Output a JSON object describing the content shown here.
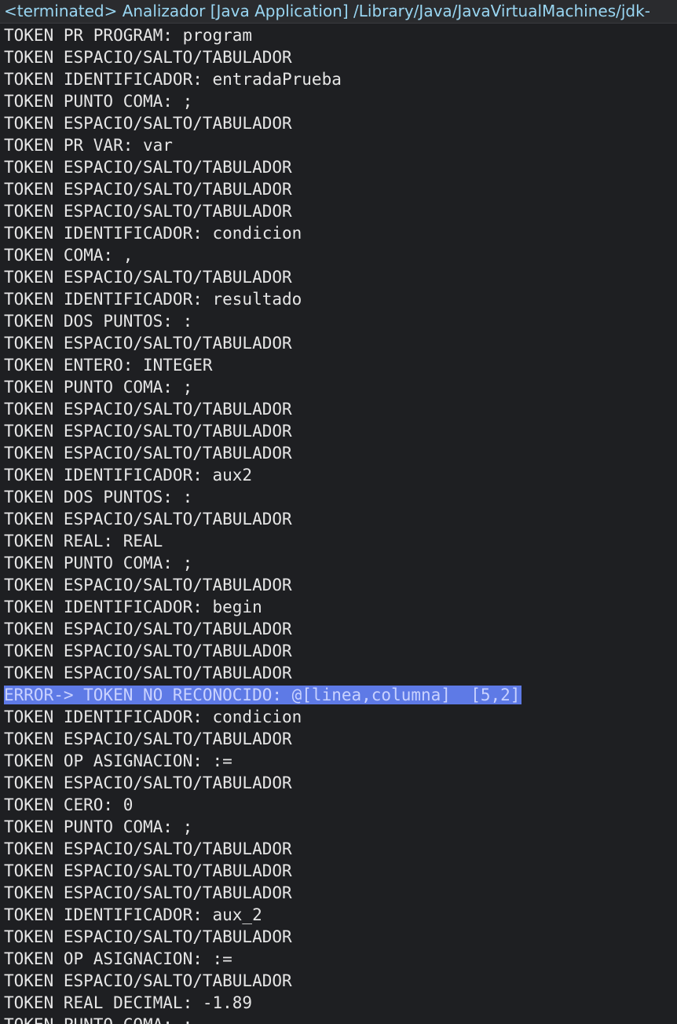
{
  "header": {
    "title": "<terminated> Analizador [Java Application] /Library/Java/JavaVirtualMachines/jdk-"
  },
  "colors": {
    "background": "#1e1f22",
    "header_text": "#99d6f2",
    "output_text": "#e6e6e6",
    "selection_background": "#5e7ae6",
    "selection_text": "#c9d2ff"
  },
  "console": {
    "lines": [
      "TOKEN PR PROGRAM: program",
      "TOKEN ESPACIO/SALTO/TABULADOR",
      "TOKEN IDENTIFICADOR: entradaPrueba",
      "TOKEN PUNTO COMA: ;",
      "TOKEN ESPACIO/SALTO/TABULADOR",
      "TOKEN PR VAR: var",
      "TOKEN ESPACIO/SALTO/TABULADOR",
      "TOKEN ESPACIO/SALTO/TABULADOR",
      "TOKEN ESPACIO/SALTO/TABULADOR",
      "TOKEN IDENTIFICADOR: condicion",
      "TOKEN COMA: ,",
      "TOKEN ESPACIO/SALTO/TABULADOR",
      "TOKEN IDENTIFICADOR: resultado",
      "TOKEN DOS PUNTOS: :",
      "TOKEN ESPACIO/SALTO/TABULADOR",
      "TOKEN ENTERO: INTEGER",
      "TOKEN PUNTO COMA: ;",
      "TOKEN ESPACIO/SALTO/TABULADOR",
      "TOKEN ESPACIO/SALTO/TABULADOR",
      "TOKEN ESPACIO/SALTO/TABULADOR",
      "TOKEN IDENTIFICADOR: aux2",
      "TOKEN DOS PUNTOS: :",
      "TOKEN ESPACIO/SALTO/TABULADOR",
      "TOKEN REAL: REAL",
      "TOKEN PUNTO COMA: ;",
      "TOKEN ESPACIO/SALTO/TABULADOR",
      "TOKEN IDENTIFICADOR: begin",
      "TOKEN ESPACIO/SALTO/TABULADOR",
      "TOKEN ESPACIO/SALTO/TABULADOR",
      "TOKEN ESPACIO/SALTO/TABULADOR",
      "ERROR-> TOKEN NO RECONOCIDO: @[linea,columna]  [5,2]",
      "TOKEN IDENTIFICADOR: condicion",
      "TOKEN ESPACIO/SALTO/TABULADOR",
      "TOKEN OP ASIGNACION: :=",
      "TOKEN ESPACIO/SALTO/TABULADOR",
      "TOKEN CERO: 0",
      "TOKEN PUNTO COMA: ;",
      "TOKEN ESPACIO/SALTO/TABULADOR",
      "TOKEN ESPACIO/SALTO/TABULADOR",
      "TOKEN ESPACIO/SALTO/TABULADOR",
      "TOKEN IDENTIFICADOR: aux_2",
      "TOKEN ESPACIO/SALTO/TABULADOR",
      "TOKEN OP ASIGNACION: :=",
      "TOKEN ESPACIO/SALTO/TABULADOR",
      "TOKEN REAL DECIMAL: -1.89",
      "TOKEN PUNTO COMA: ;"
    ],
    "highlighted_line": 30
  }
}
